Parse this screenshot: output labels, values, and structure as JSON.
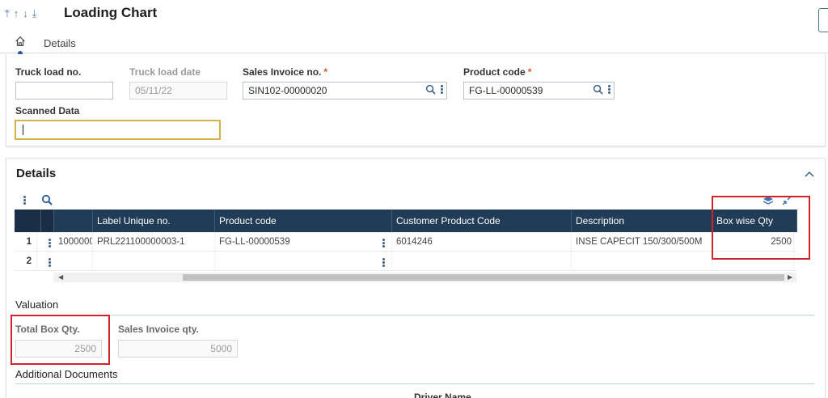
{
  "header": {
    "title": "Loading Chart",
    "tabs": {
      "details": "Details"
    }
  },
  "form": {
    "truck_load_no": {
      "label": "Truck load no.",
      "value": ""
    },
    "truck_load_date": {
      "label": "Truck load date",
      "value": "05/11/22"
    },
    "sales_invoice_no": {
      "label": "Sales Invoice no.",
      "required_mark": "*",
      "value": "SIN102-00000020"
    },
    "product_code": {
      "label": "Product code",
      "required_mark": "*",
      "value": "FG-LL-00000539"
    },
    "scanned_data": {
      "label": "Scanned Data",
      "value": ""
    }
  },
  "details": {
    "title": "Details",
    "columns": [
      "",
      "Label Unique no.",
      "Product code",
      "Customer Product Code",
      "Description",
      "Box wise Qty"
    ],
    "rows": [
      {
        "num": "1",
        "cells": [
          "1000000",
          "PRL221100000003-1",
          "FG-LL-00000539",
          "6014246",
          "INSE CAPECIT 150/300/500M",
          "2500"
        ]
      },
      {
        "num": "2",
        "cells": [
          "",
          "",
          "",
          "",
          "",
          ""
        ]
      }
    ]
  },
  "valuation": {
    "title": "Valuation",
    "total_box_qty": {
      "label": "Total Box Qty.",
      "value": "2500"
    },
    "sales_invoice_qty": {
      "label": "Sales Invoice qty.",
      "value": "5000"
    }
  },
  "additional": {
    "title": "Additional Documents",
    "peek_label": "Driver Name"
  },
  "colors": {
    "accent": "#213c57",
    "highlight": "#d0242a",
    "required": "#d6542d"
  }
}
